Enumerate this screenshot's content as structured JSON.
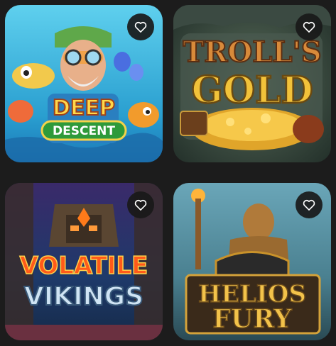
{
  "games": [
    {
      "id": "deep-descent",
      "title_line1": "DEEP",
      "title_line2": "DESCENT",
      "favorite_icon": "heart-outline-icon"
    },
    {
      "id": "trolls-gold",
      "title_line1": "TROLL'S",
      "title_line2": "GOLD",
      "favorite_icon": "heart-outline-icon"
    },
    {
      "id": "volatile-vikings",
      "title_line1": "VOLATILE",
      "title_line2": "VIKINGS",
      "favorite_icon": "heart-outline-icon"
    },
    {
      "id": "helios-fury",
      "title_line1": "HELIOS",
      "title_line2": "FURY",
      "favorite_icon": "heart-outline-icon"
    }
  ],
  "colors": {
    "page_background": "#1c1c1c",
    "favorite_button_bg": "#191919",
    "heart_stroke": "#ffffff"
  }
}
